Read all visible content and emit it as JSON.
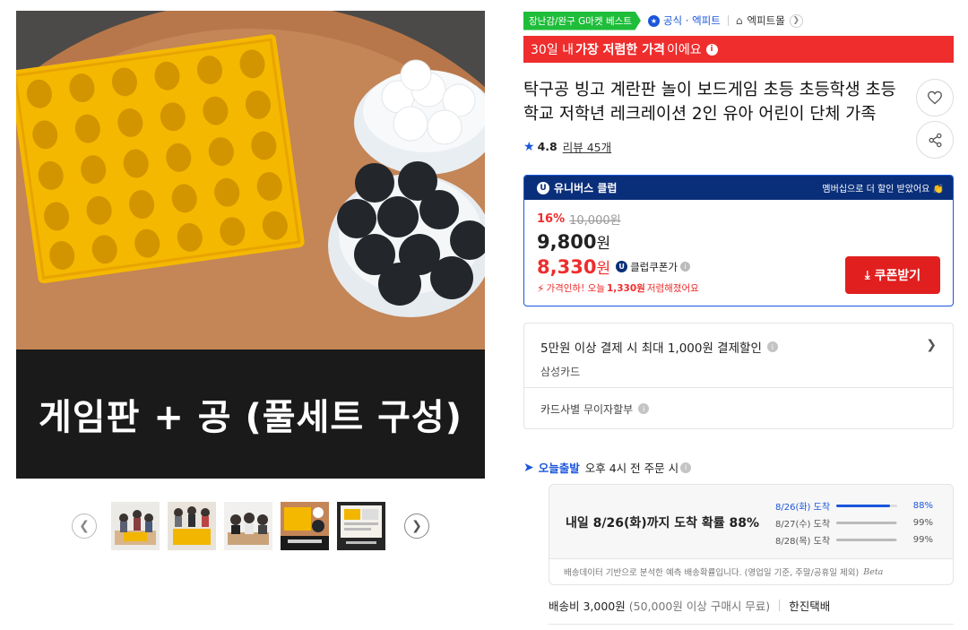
{
  "gallery": {
    "caption": "게임판 + 공 (풀세트 구성)",
    "prev_icon": "chevron-left-icon",
    "next_icon": "chevron-right-icon",
    "thumbnails": [
      {
        "name": "thumbnail-1"
      },
      {
        "name": "thumbnail-2"
      },
      {
        "name": "thumbnail-3"
      },
      {
        "name": "thumbnail-4"
      },
      {
        "name": "thumbnail-5"
      }
    ]
  },
  "badges": {
    "best": "장난감/완구 G마켓 베스트",
    "official": "공식 · 엑피트",
    "store": "엑피트몰"
  },
  "lowest_price_banner": {
    "prefix": "30일 내",
    "highlight": "가장 저렴한 가격",
    "suffix": "이에요"
  },
  "product": {
    "title": "탁구공 빙고 계란판 놀이 보드게임 초등 초등학생 초등학교 저학년 레크레이션 2인 유아 어린이 단체 가족",
    "rating": "4.8",
    "reviews": "리뷰 45개"
  },
  "club": {
    "label": "유니버스 클럽",
    "promo": "멤버십으로 더 할인 받았어요",
    "discount_rate": "16%",
    "original_price": "10,000원",
    "sale_price": "9,800",
    "sale_unit": "원",
    "club_price": "8,330",
    "club_unit": "원",
    "club_price_label": "클럽쿠폰가",
    "drop_note_prefix": "가격인하! 오늘",
    "drop_note_amount": "1,330원",
    "drop_note_suffix": "저렴해졌어요",
    "coupon_button": "쿠폰받기"
  },
  "card_promo": {
    "main": "5만원 이상 결제 시 최대 1,000원 결제할인",
    "card": "삼성카드",
    "installment": "카드사별 무이자할부"
  },
  "delivery": {
    "badge": "오늘출발",
    "cutoff": "오후 4시 전 주문 시",
    "headline": "내일 8/26(화)까지 도착 확률 88%",
    "rows": [
      {
        "date": "8/26(화) 도착",
        "pct": "88%",
        "value": 0.88
      },
      {
        "date": "8/27(수) 도착",
        "pct": "99%",
        "value": 0.99
      },
      {
        "date": "8/28(목) 도착",
        "pct": "99%",
        "value": 0.99
      }
    ],
    "note": "배송데이터 기반으로 분석한 예측 배송확률입니다. (영업일 기준, 주말/공휴일 제외)",
    "beta": "Beta"
  },
  "shipping": {
    "fee": "배송비 3,000원",
    "condition": "(50,000원 이상 구매시 무료)",
    "carrier": "한진택배"
  },
  "colors": {
    "accent_blue": "#1a56db",
    "sale_red": "#ef2d2d",
    "club_navy": "#0a2f7a",
    "best_green": "#1fbd3a"
  }
}
